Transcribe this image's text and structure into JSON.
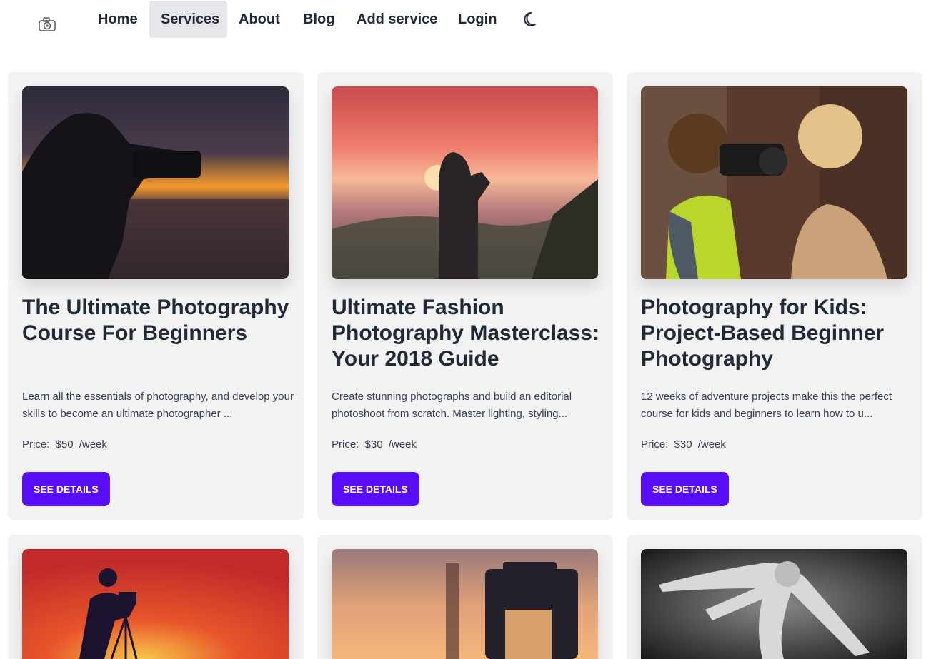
{
  "nav": {
    "items": [
      {
        "label": "Home"
      },
      {
        "label": "Services"
      },
      {
        "label": "About"
      },
      {
        "label": "Blog"
      },
      {
        "label": "Add service"
      },
      {
        "label": "Login"
      }
    ],
    "active": "Services",
    "logo_icon": "camera-icon",
    "theme_icon": "moon-icon"
  },
  "colors": {
    "accent": "#570df8",
    "card_bg": "#f2f2f2",
    "active_nav_bg": "#e5e7eb",
    "text": "#1f2937"
  },
  "services": [
    {
      "title": "The Ultimate Photography Course For Beginners",
      "description": "Learn all the essentials of photography, and develop your skills to become an ultimate photographer ...",
      "price_label": "Price:",
      "price": "$50",
      "period": "/week",
      "button": "SEE DETAILS"
    },
    {
      "title": "Ultimate Fashion Photography Masterclass: Your 2018 Guide",
      "description": "Create stunning photographs and build an editorial photoshoot from scratch. Master lighting, styling...",
      "price_label": "Price:",
      "price": "$30",
      "period": "/week",
      "button": "SEE DETAILS"
    },
    {
      "title": "Photography for Kids: Project-Based Beginner Photography",
      "description": "12 weeks of adventure projects make this the perfect course for kids and beginners to learn how to u...",
      "price_label": "Price:",
      "price": "$30",
      "period": "/week",
      "button": "SEE DETAILS"
    },
    {
      "title": "",
      "description": "",
      "price_label": "",
      "price": "",
      "period": "",
      "button": ""
    },
    {
      "title": "",
      "description": "",
      "price_label": "",
      "price": "",
      "period": "",
      "button": ""
    },
    {
      "title": "",
      "description": "",
      "price_label": "",
      "price": "",
      "period": "",
      "button": ""
    }
  ]
}
